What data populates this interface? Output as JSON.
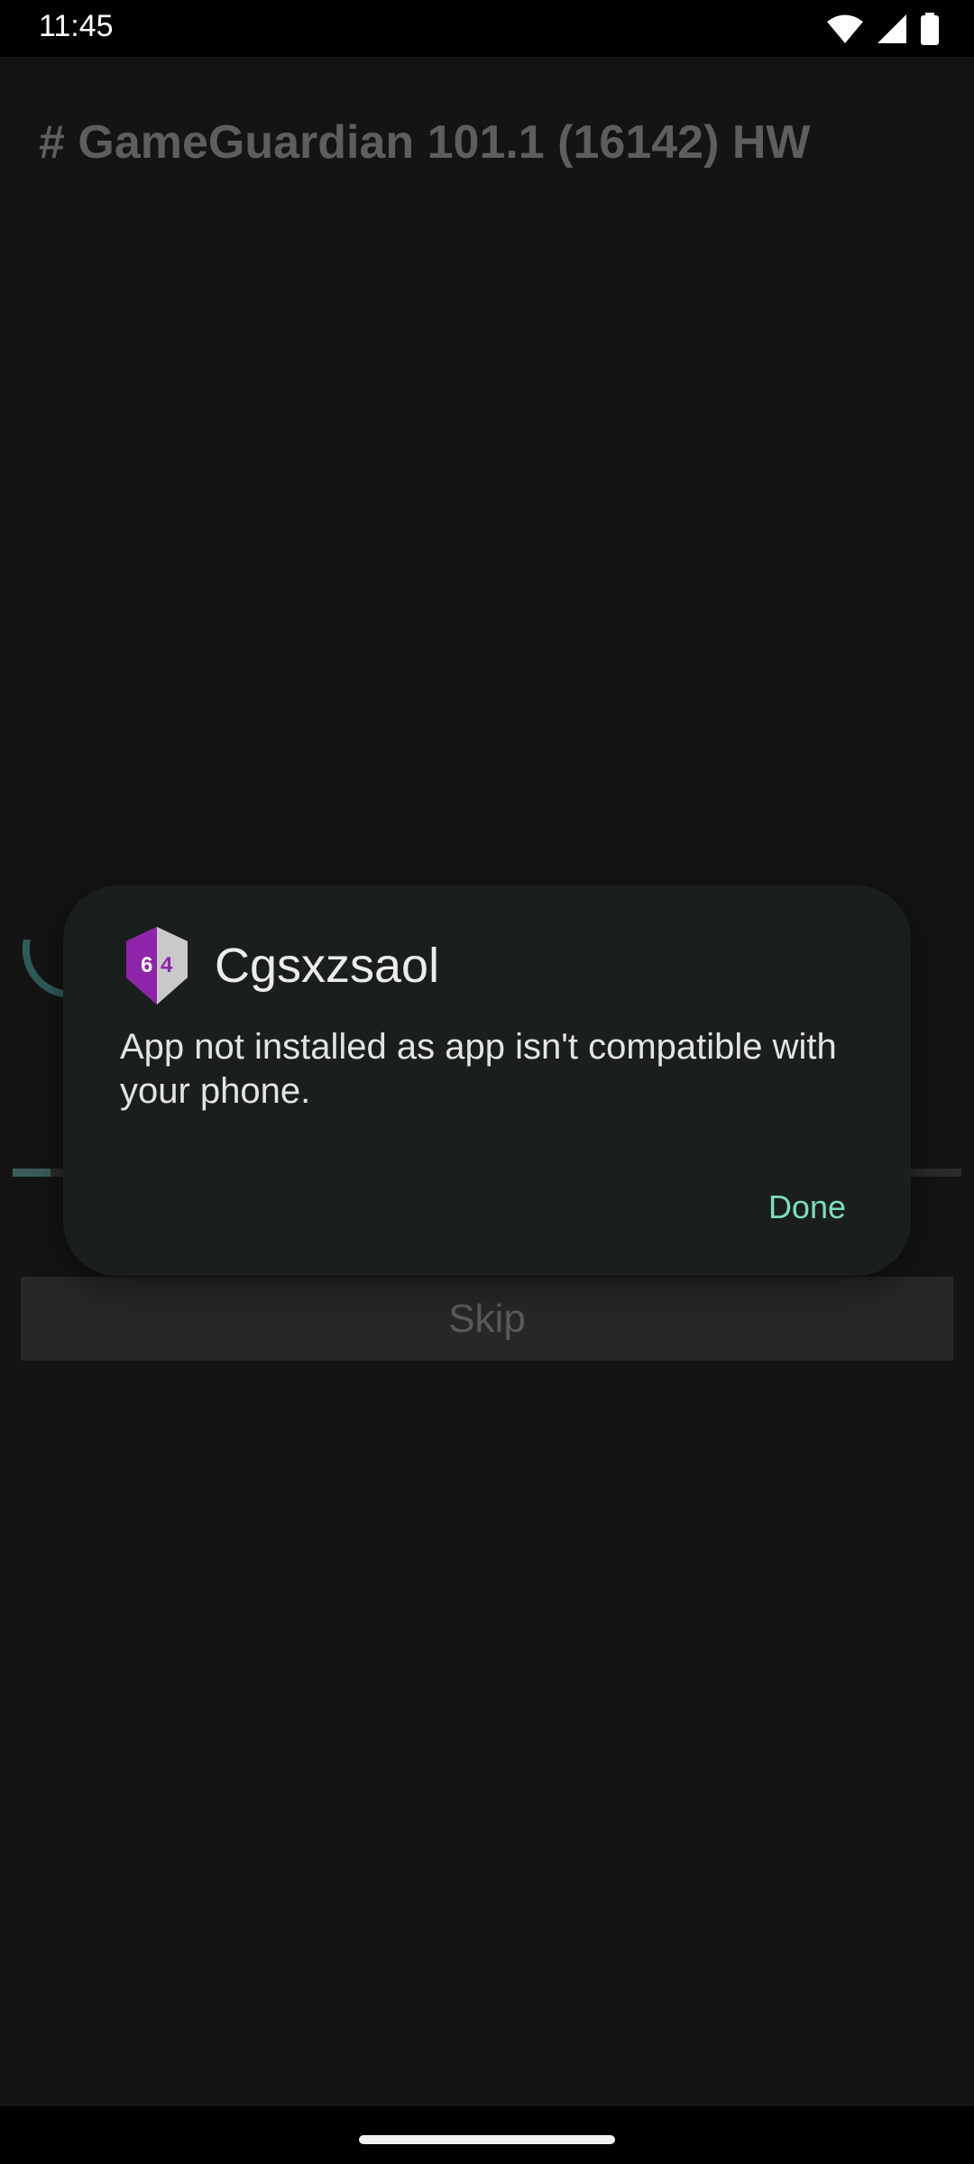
{
  "status_bar": {
    "time": "11:45",
    "icons": [
      "wifi-icon",
      "cellular-signal-icon",
      "battery-icon"
    ]
  },
  "app": {
    "title": "# GameGuardian 101.1 (16142) HW",
    "skip_label": "Skip",
    "progress_fraction": 0.04
  },
  "dialog": {
    "app_name": "Cgsxzsaol",
    "icon": "gameguardian-64-shield-icon",
    "message": "App not installed as app isn't compatible with your phone.",
    "done_label": "Done",
    "accent_color": "#7fdcc0"
  }
}
